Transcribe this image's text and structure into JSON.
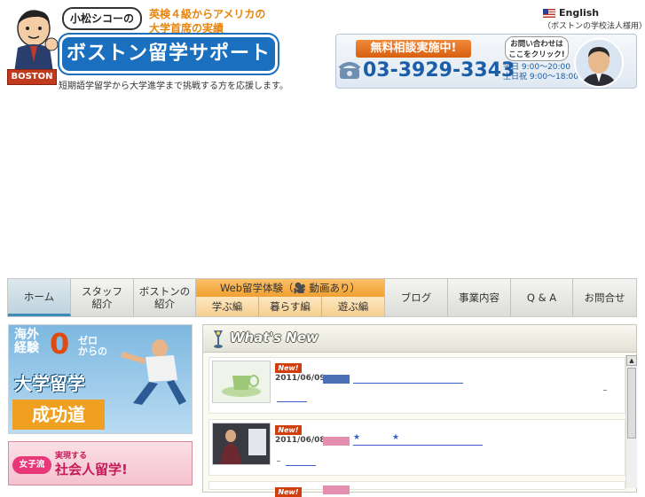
{
  "header": {
    "bubble": "小松シコーの",
    "tagline_line1": "英検４級からアメリカの",
    "tagline_line2": "大学首席の実績",
    "brand": "ボストン留学サポート",
    "boston_tag": "BOSTON",
    "subtitle": "短期語学留学から大学進学まで挑戦する方を応援します。",
    "english_link": "English",
    "english_note": "（ボストンの学校法人様用）"
  },
  "consult": {
    "label": "無料相談実施中!",
    "phone": "03-3929-3343",
    "hours_weekday": "平日 9:00〜20:00",
    "hours_weekend": "土日祝 9:00〜18:00",
    "ask_line1": "お問い合わせは",
    "ask_line2": "ここをクリック!"
  },
  "nav": {
    "home": "ホーム",
    "staff": [
      "スタッフ",
      "紹介"
    ],
    "boston": [
      "ボストンの",
      "紹介"
    ],
    "web_head": "Web留学体験（🎥 動画あり）",
    "web_subs": [
      "学ぶ編",
      "暮らす編",
      "遊ぶ編"
    ],
    "blog": "ブログ",
    "business": "事業内容",
    "qa": "Q & A",
    "contact": "お問合せ"
  },
  "banner_study": {
    "top_line1": "海外",
    "top_line2": "経験",
    "zero": "0",
    "kara_line1": "ゼロ",
    "kara_line2": "からの",
    "big": "大学留学",
    "success": "成功道"
  },
  "banner_women": {
    "tag": "女子流",
    "small": "実現する",
    "text": "社会人留学!"
  },
  "news": {
    "title": "What's New",
    "items": [
      {
        "badge": "New!",
        "date": "2011/06/09",
        "cat_color": "#4a6fb5"
      },
      {
        "badge": "New!",
        "date": "2011/06/08",
        "cat_color": "#e58fb0"
      }
    ],
    "colors": {
      "link": "#3a5ec8",
      "badge": "#d23d0c"
    }
  }
}
